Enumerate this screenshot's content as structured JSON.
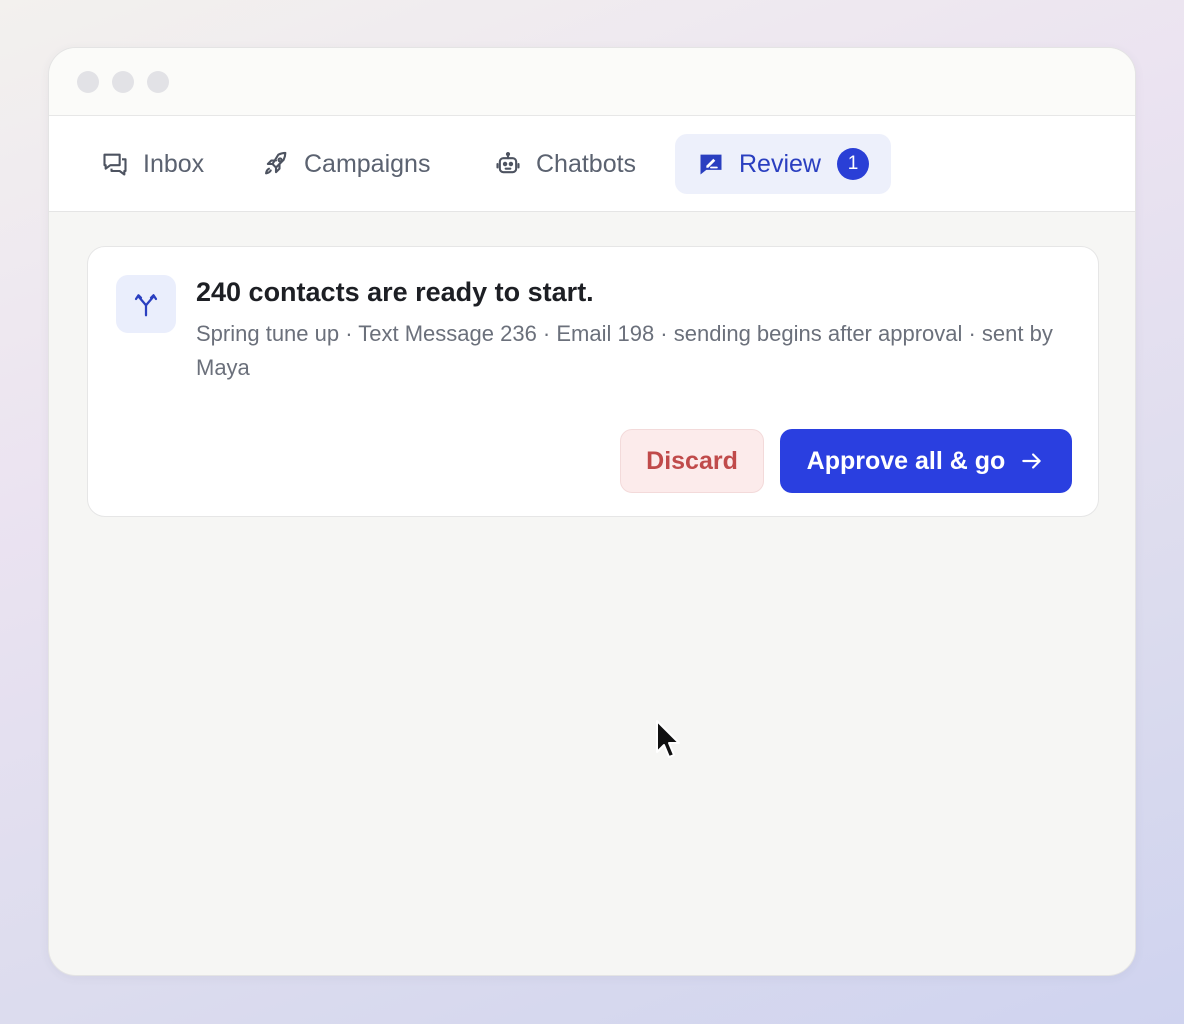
{
  "window": {
    "traffic_lights": [
      "close",
      "minimize",
      "zoom"
    ]
  },
  "tabs": [
    {
      "label": "Inbox",
      "icon": "inbox-chat-icon",
      "active": false
    },
    {
      "label": "Campaigns",
      "icon": "rocket-icon",
      "active": false
    },
    {
      "label": "Chatbots",
      "icon": "robot-icon",
      "active": false
    },
    {
      "label": "Review",
      "icon": "review-sign-icon",
      "active": true,
      "badge": "1"
    }
  ],
  "card": {
    "icon": "split-arrows-icon",
    "title": "240 contacts are ready to start.",
    "subtitle": "Spring tune up · Text Message 236 · Email 198 · sending begins after approval · sent by Maya",
    "discard_label": "Discard",
    "approve_label": "Approve all & go"
  },
  "colors": {
    "accent": "#2a3fe0",
    "active_tab_bg": "#edf0fb",
    "danger_text": "#c04a4a",
    "danger_bg": "#fcebeb"
  }
}
